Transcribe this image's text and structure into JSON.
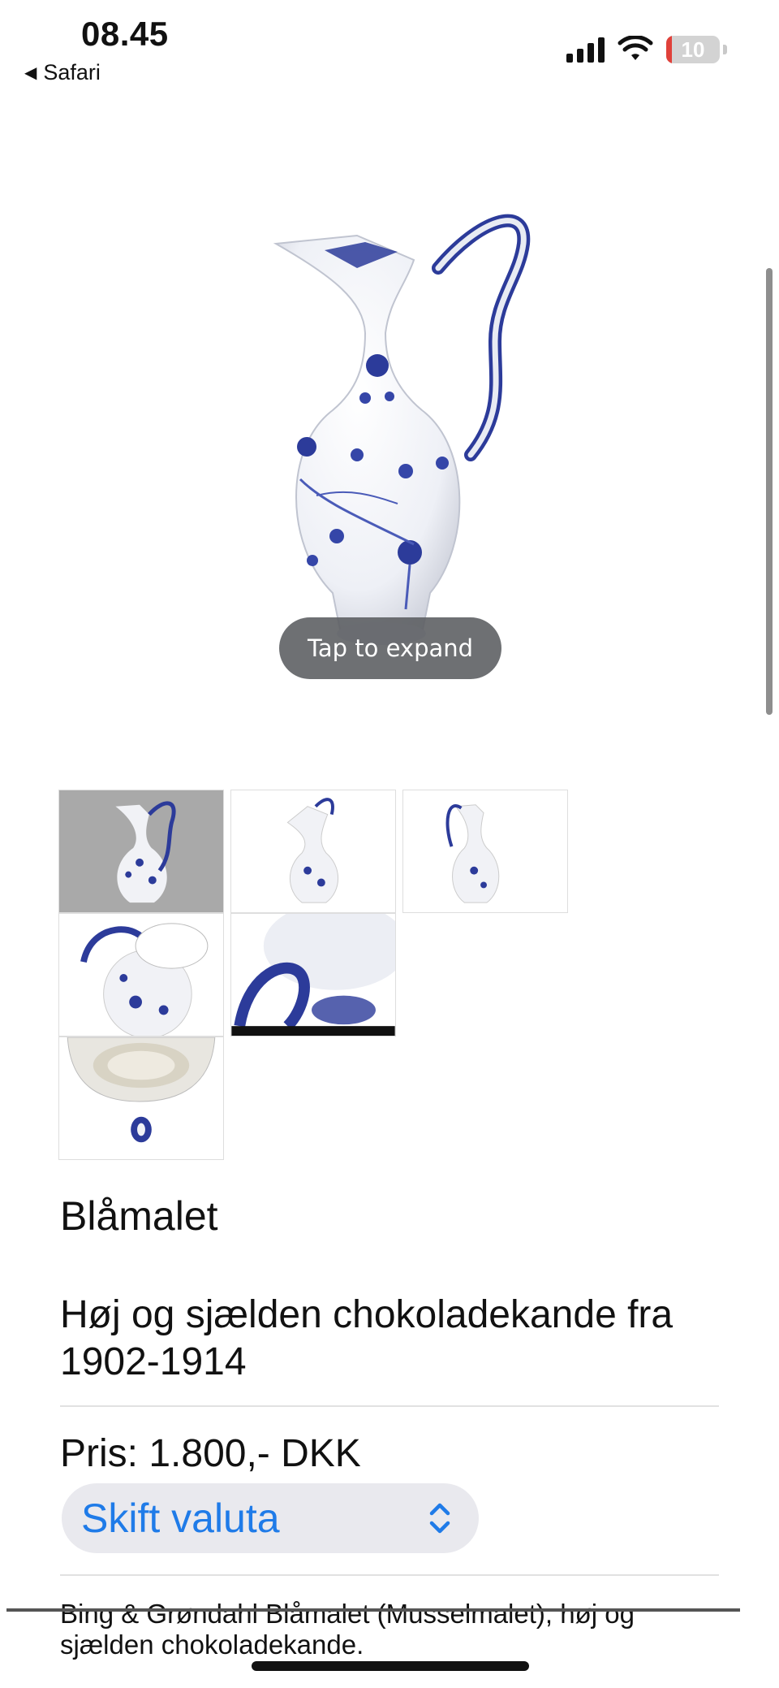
{
  "status_bar": {
    "time": "08.45",
    "back_app": "Safari",
    "battery_level": "10"
  },
  "product": {
    "image_hint": "Tap to expand",
    "collection": "Blåmalet",
    "title": "Høj og sjælden chokoladekande fra 1902-1914",
    "price": "Pris: 1.800,- DKK",
    "currency_button": "Skift valuta",
    "description": "Bing & Grøndahl Blåmalet (Musselmalet), høj og sjælden chokoladekande."
  },
  "thumbnails": [
    {
      "name": "front-view",
      "selected": true
    },
    {
      "name": "side-view",
      "selected": false
    },
    {
      "name": "back-view",
      "selected": false
    },
    {
      "name": "top-view",
      "selected": false
    },
    {
      "name": "handle-detail",
      "selected": false
    },
    {
      "name": "base-stamp",
      "selected": false
    }
  ],
  "colors": {
    "accent": "#1f7be8",
    "porcelain_blue": "#27358f",
    "battery_low": "#e0413a"
  },
  "icons": [
    "back-triangle-icon",
    "signal-icon",
    "wifi-icon",
    "battery-icon",
    "chevron-updown-icon"
  ]
}
